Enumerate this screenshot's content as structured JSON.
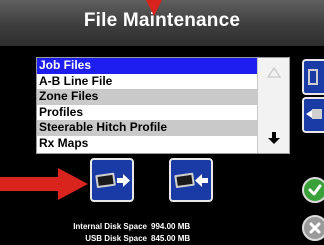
{
  "window": {
    "title": "File Maintenance"
  },
  "file_list": {
    "items": [
      {
        "label": "Job Files",
        "selected": true
      },
      {
        "label": "A-B Line File",
        "selected": false
      },
      {
        "label": "Zone Files",
        "selected": false
      },
      {
        "label": "Profiles",
        "selected": false
      },
      {
        "label": "Steerable Hitch Profile",
        "selected": false
      },
      {
        "label": "Rx Maps",
        "selected": false
      }
    ]
  },
  "disk_info": {
    "internal_label": "Internal Disk Space",
    "internal_value": "994.00 MB",
    "usb_label": "USB Disk Space",
    "usb_value": "845.00 MB"
  },
  "icons": {
    "export": "usb-export-icon",
    "import": "usb-import-icon",
    "accept": "checkmark-icon",
    "cancel": "close-icon"
  },
  "colors": {
    "selection": "#1e1ef0",
    "button_blue": "#1a3ba6",
    "annotation_red": "#d9231d",
    "accept_green": "#3aa13a"
  }
}
